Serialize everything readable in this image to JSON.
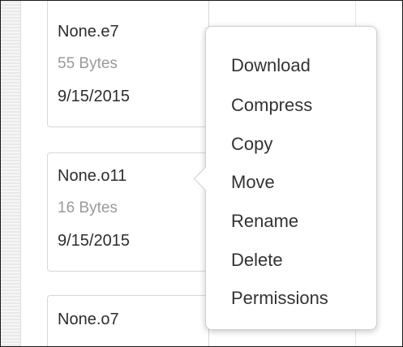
{
  "files": [
    {
      "name": "None.e7",
      "size": "55 Bytes",
      "date": "9/15/2015"
    },
    {
      "name": "None.o11",
      "size": "16 Bytes",
      "date": "9/15/2015"
    },
    {
      "name": "None.o7"
    }
  ],
  "context_menu": {
    "items": [
      {
        "label": "Download"
      },
      {
        "label": "Compress"
      },
      {
        "label": "Copy"
      },
      {
        "label": "Move"
      },
      {
        "label": "Rename"
      },
      {
        "label": "Delete"
      },
      {
        "label": "Permissions"
      }
    ]
  }
}
